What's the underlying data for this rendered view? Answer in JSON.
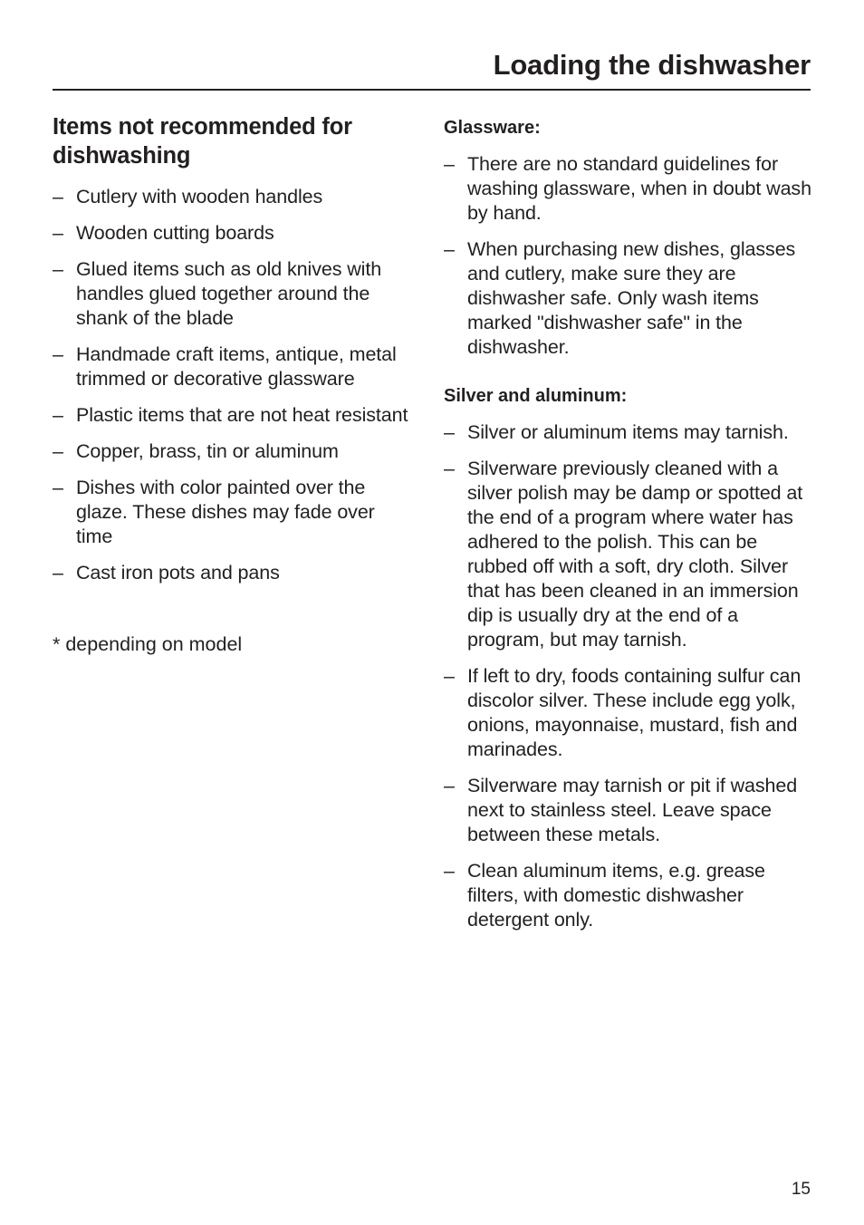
{
  "header": {
    "title": "Loading the dishwasher"
  },
  "left_column": {
    "heading": "Items not recommended for dishwashing",
    "items": [
      "Cutlery with wooden handles",
      "Wooden cutting boards",
      "Glued items such as old knives with handles glued together around the shank of the blade",
      "Handmade craft items, antique, metal trimmed or decorative glassware",
      "Plastic items that are not heat resistant",
      "Copper, brass, tin or aluminum",
      "Dishes with color painted over the glaze. These dishes may fade over time",
      "Cast iron pots and pans"
    ],
    "footnote": "* depending on model"
  },
  "right_column": {
    "sections": [
      {
        "heading": "Glassware:",
        "items": [
          "There are no standard guidelines for washing glassware, when in doubt wash by hand.",
          "When purchasing new dishes, glasses and cutlery, make sure they are dishwasher safe. Only wash items marked \"dishwasher safe\" in the dishwasher."
        ]
      },
      {
        "heading": "Silver and aluminum:",
        "items": [
          "Silver or aluminum items may tarnish.",
          "Silverware previously cleaned with a silver polish may be damp or spotted at the end of a program where water has adhered to the polish. This can be rubbed off with a soft, dry cloth. Silver that has been cleaned in an immersion dip is usually dry at the end of a program, but may tarnish.",
          "If left to dry, foods containing sulfur can discolor silver. These include egg yolk, onions, mayonnaise, mustard, fish and marinades.",
          "Silverware may tarnish or pit if washed next to stainless steel. Leave space between these metals.",
          "Clean aluminum items, e.g. grease filters, with domestic dishwasher detergent only."
        ]
      }
    ]
  },
  "bullet_glyph": "–",
  "footer": {
    "page_number": "15"
  }
}
